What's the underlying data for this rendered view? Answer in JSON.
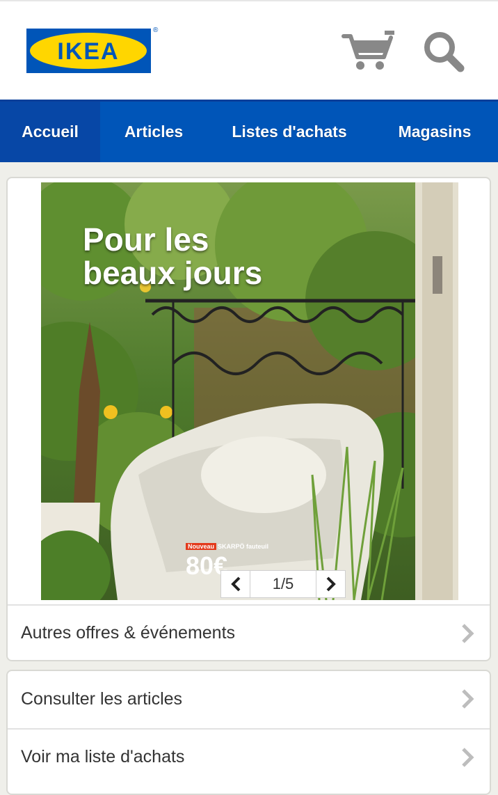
{
  "header": {
    "logo_text": "IKEA",
    "cart_icon": "cart-icon",
    "search_icon": "search-icon"
  },
  "nav": {
    "items": [
      {
        "label": "Accueil",
        "active": true
      },
      {
        "label": "Articles",
        "active": false
      },
      {
        "label": "Listes d'achats",
        "active": false
      },
      {
        "label": "Magasins",
        "active": false
      }
    ]
  },
  "hero": {
    "title_line1": "Pour les",
    "title_line2": "beaux jours",
    "promo_badge": "Nouveau",
    "promo_product": "SKARPÖ fauteuil",
    "promo_price": "80€",
    "pager": "1/5"
  },
  "links": {
    "offers": "Autres offres & événements",
    "browse": "Consulter les articles",
    "shopping_list": "Voir ma liste d'achats"
  },
  "colors": {
    "brand_blue": "#0055b8",
    "brand_yellow": "#ffd600",
    "active_tab": "#0747a6",
    "icon_gray": "#888888"
  }
}
